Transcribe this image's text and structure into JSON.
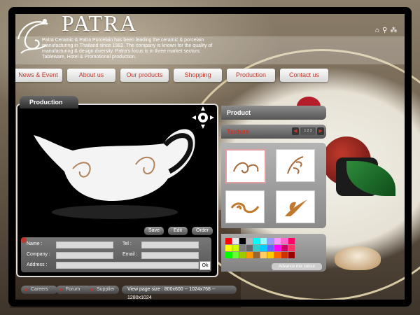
{
  "header": {
    "brand": "PATRA",
    "intro": "Patra Ceramic & Patra Porcelain has been leading the ceramic & porcelain manufacturing in Thailand since 1982. The company is known for the quality of manufacturing & design diversity. Patra's focus is in three market sectors: Tableware, Hotel & Promotional production."
  },
  "nav": {
    "items": [
      {
        "label": "News & Event"
      },
      {
        "label": "About us"
      },
      {
        "label": "Our products"
      },
      {
        "label": "Shopping"
      },
      {
        "label": "Production"
      },
      {
        "label": "Contact us"
      }
    ]
  },
  "production": {
    "tab_label": "Production",
    "buttons": {
      "save": "Save",
      "edit": "Edit",
      "order": "Order"
    },
    "form": {
      "name_label": "Name :",
      "company_label": "Company :",
      "address_label": "Address :",
      "tel_label": "Tel :",
      "email_label": "Email :",
      "ok_label": "Ok"
    }
  },
  "side": {
    "product_label": "Product",
    "texture_label": "Texture",
    "pager_text": "1 2 3"
  },
  "colors": {
    "accent": "#c0392b",
    "palette": [
      "#ff0000",
      "#e6e6e6",
      "#000000",
      "#b3b3b3",
      "#00ffff",
      "#99ffff",
      "#9999ff",
      "#ff99ff",
      "#ff66cc",
      "#ff0066",
      "#ffff00",
      "#ccff00",
      "#808080",
      "#666666",
      "#33cccc",
      "#00ccff",
      "#6666ff",
      "#ff00ff",
      "#cc0066",
      "#ff3366",
      "#00ff00",
      "#66ff33",
      "#99cc00",
      "#ff9900",
      "#996633",
      "#ffcc66",
      "#ffcc00",
      "#ff6600",
      "#cc3300",
      "#990000"
    ]
  },
  "mix_button": "Advance mix colour",
  "footer": {
    "careers": "Careers",
    "forum": "Forum",
    "supplier": "Supplier",
    "view_size": "View page size : 800x600 -- 1024x768 -- 1280x1024"
  }
}
